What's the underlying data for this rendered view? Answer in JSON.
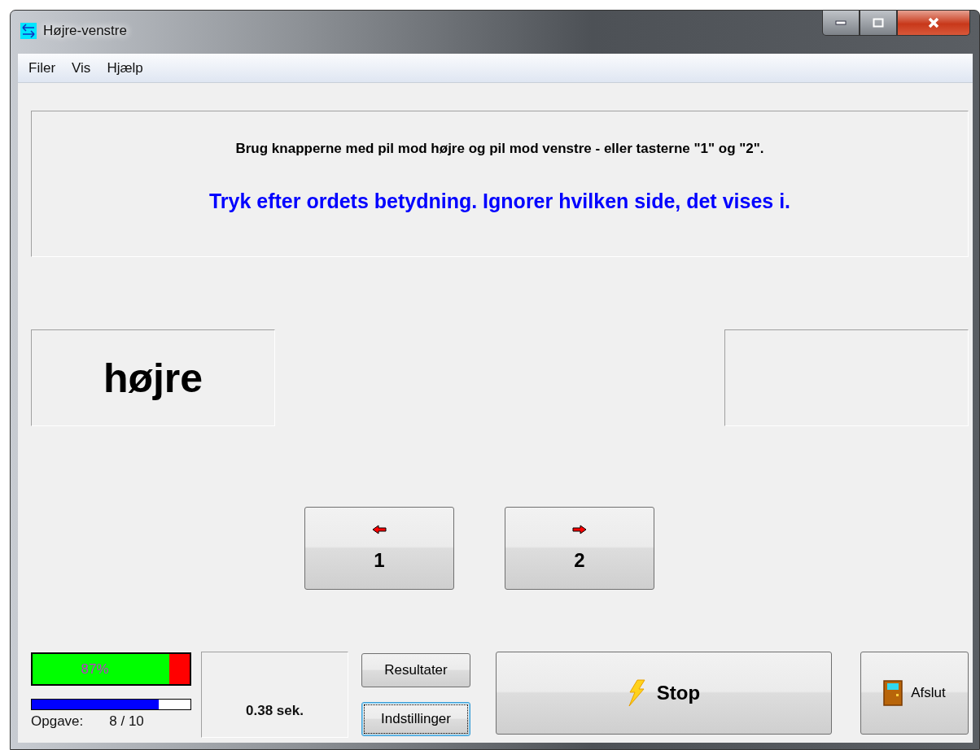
{
  "window": {
    "title": "Højre-venstre"
  },
  "menu": [
    {
      "label": "Filer"
    },
    {
      "label": "Vis"
    },
    {
      "label": "Hjælp"
    }
  ],
  "instructions": {
    "text": "Brug knapperne med pil mod højre og pil mod venstre - eller tasterne \"1\" og \"2\".",
    "task": "Tryk efter ordets betydning. Ignorer hvilken side, det vises i."
  },
  "left_word": "højre",
  "answer_buttons": [
    {
      "kind": "left",
      "label": "1"
    },
    {
      "kind": "right",
      "label": "2"
    }
  ],
  "score": {
    "label": "87%",
    "level": 0.87
  },
  "progress": {
    "level": 0.8,
    "label": "Opgave:",
    "value": "8 / 10"
  },
  "time": "0.38 sek.",
  "buttons": [
    {
      "label": "Resultater",
      "focused": false
    },
    {
      "label": "Indstillinger",
      "focused": true
    }
  ],
  "stop_button": "Stop",
  "exit_button": "Afslut"
}
